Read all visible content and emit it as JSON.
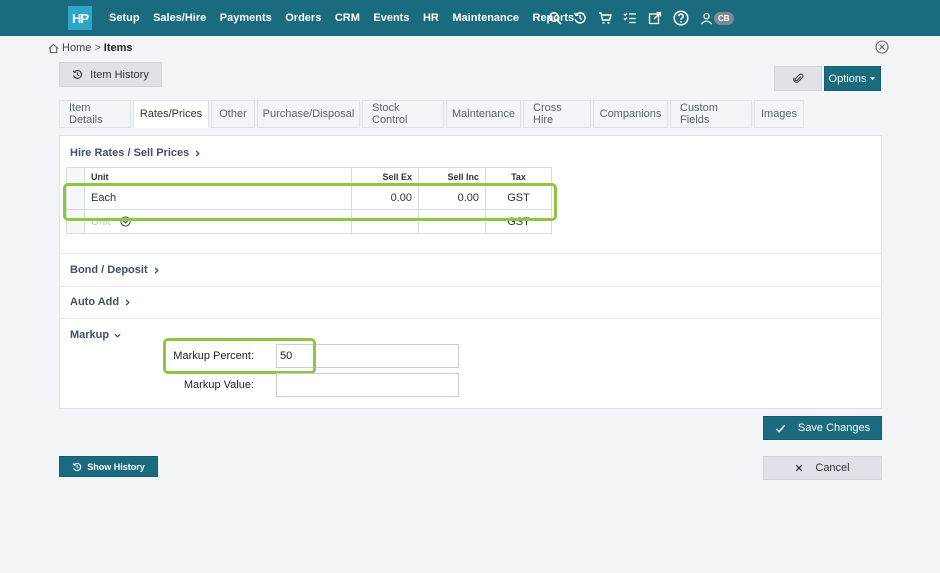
{
  "nav": {
    "logo": "HP",
    "items": [
      "Setup",
      "Sales/Hire",
      "Payments",
      "Orders",
      "CRM",
      "Events",
      "HR",
      "Maintenance",
      "Reports"
    ],
    "user_initials": "CB"
  },
  "breadcrumb": {
    "home": "Home",
    "separator": ">",
    "current": "Items"
  },
  "toolbar": {
    "item_history_label": "Item History",
    "options_label": "Options"
  },
  "tabs": [
    "Item Details",
    "Rates/Prices",
    "Other",
    "Purchase/Disposal",
    "Stock Control",
    "Maintenance",
    "Cross Hire",
    "Companions",
    "Custom Fields",
    "Images"
  ],
  "active_tab": "Rates/Prices",
  "hire_rates": {
    "title": "Hire Rates / Sell Prices",
    "columns": {
      "unit": "Unit",
      "sell_ex": "Sell Ex",
      "sell_inc": "Sell Inc",
      "tax": "Tax"
    },
    "rows": [
      {
        "unit": "Each",
        "sell_ex": "0.00",
        "sell_inc": "0.00",
        "tax": "GST"
      }
    ],
    "new_row": {
      "unit_placeholder": "Unit",
      "tax": "GST"
    }
  },
  "sections": {
    "bond": "Bond / Deposit",
    "auto_add": "Auto Add",
    "markup": "Markup"
  },
  "markup": {
    "percent_label": "Markup Percent:",
    "percent_value": "50",
    "value_label": "Markup Value:",
    "value_value": ""
  },
  "actions": {
    "save": "Save Changes",
    "cancel": "Cancel",
    "show_history": "Show History"
  },
  "colors": {
    "nav_bg": "#1b6b7f",
    "highlight": "#8dc63f"
  }
}
